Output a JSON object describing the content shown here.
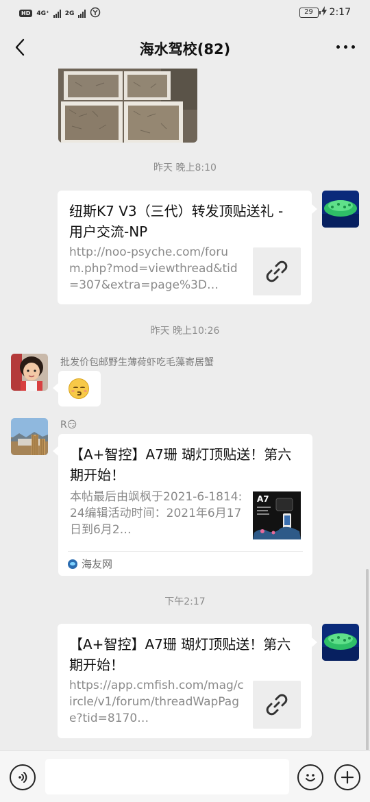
{
  "status_bar": {
    "hd_label": "HD",
    "net1": "4G⁺",
    "net2": "2G",
    "battery": "29",
    "time": "2:17"
  },
  "nav": {
    "title": "海水驾校(82)",
    "back_icon": "chevron-left-icon",
    "more_icon": "more-dots-icon"
  },
  "messages": {
    "ts1": "昨天 晚上8:10",
    "link1": {
      "title": "纽斯K7 V3（三代）转发顶贴送礼 - 用户交流-NP",
      "desc": "http://noo-psyche.com/forum.php?mod=viewthread&tid=307&extra=page%3D…"
    },
    "ts2": "昨天 晚上10:26",
    "sender1": "批发价包邮野生薄荷虾吃毛藻寄居蟹",
    "emoji1": "😚",
    "sender2": "R😏",
    "article": {
      "title": "【A+智控】A7珊 瑚灯顶贴送！第六期开始！",
      "desc": "本帖最后由飒枫于2021-6-1814:24编辑活动时间：2021年6月17日到6月2…",
      "thumb_label": "A7",
      "source": "海友网"
    },
    "ts3": "下午2:17",
    "link2": {
      "title": "【A+智控】A7珊 瑚灯顶贴送！第六期开始！",
      "desc": "https://app.cmfish.com/mag/circle/v1/forum/threadWapPage?tid=8170…"
    }
  },
  "input_bar": {
    "voice_icon": "voice-icon",
    "emoji_icon": "emoji-icon",
    "plus_icon": "plus-icon"
  },
  "colors": {
    "background": "#ededed",
    "card": "#ffffff",
    "timestamp": "#8c8c8c",
    "link_desc": "#8a8a8a"
  }
}
